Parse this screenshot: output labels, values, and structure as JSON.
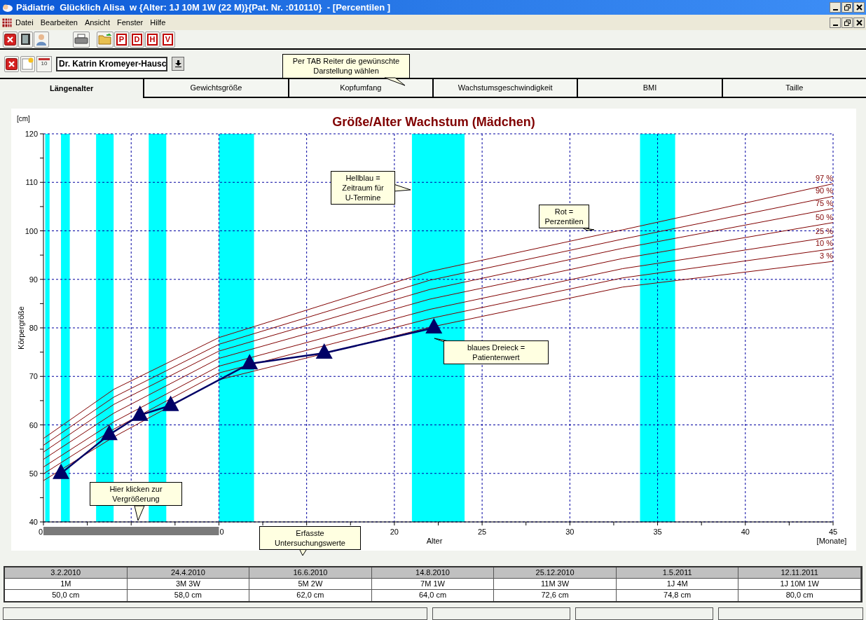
{
  "window": {
    "title": "Pädiatrie  Glücklich Alisa  w {Alter: 1J 10M 1W (22 M)}{Pat. Nr. :010110}  - [Percentilen ]"
  },
  "menu": [
    "Datei",
    "Bearbeiten",
    "Ansicht",
    "Fenster",
    "Hilfe"
  ],
  "toolbar": {
    "letter_buttons": [
      "P",
      "D",
      "H",
      "V"
    ]
  },
  "doctor_bar": {
    "calendar_day": "10",
    "doctor": "Dr. Katrin Kromeyer-Hausc"
  },
  "tab_hint": [
    "Per TAB Reiter die gewünschte",
    "Darstellung wählen"
  ],
  "tabs": [
    {
      "label": "Längenalter",
      "selected": true
    },
    {
      "label": "Gewichtsgröße",
      "selected": false
    },
    {
      "label": "Kopfumfang",
      "selected": false
    },
    {
      "label": "Wachstumsgeschwindigkeit",
      "selected": false
    },
    {
      "label": "BMI",
      "selected": false
    },
    {
      "label": "Taille",
      "selected": false
    }
  ],
  "chart": {
    "y_unit": "[cm]",
    "x_unit": "[Monate]",
    "callouts": [
      {
        "lines": [
          "Hellblau =",
          "Zeitraum für",
          "U-Termine"
        ]
      },
      {
        "lines": [
          "Rot =",
          "Perzentilen"
        ]
      },
      {
        "lines": [
          "blaues Dreieck =",
          "Patientenwert"
        ]
      },
      {
        "lines": [
          "Hier klicken zur",
          "Vergrößerung"
        ]
      },
      {
        "lines": [
          "Erfasste",
          "Untersuchungswerte"
        ]
      }
    ],
    "chart_data": {
      "type": "line",
      "title": "Größe/Alter Wachstum (Mädchen)",
      "xlabel": "Alter",
      "ylabel": "Körpergröße",
      "xlim": [
        0,
        45
      ],
      "ylim": [
        40,
        120
      ],
      "grid": true,
      "xticks": [
        20,
        25,
        30,
        35,
        40,
        45
      ],
      "yticks": [
        40,
        50,
        60,
        70,
        80,
        90,
        100,
        110,
        120
      ],
      "series": [
        {
          "name": "97 %",
          "color": "#800000",
          "x": [
            0,
            4,
            10,
            22,
            33,
            45
          ],
          "values": [
            57.2,
            67.3,
            78.0,
            91.6,
            100.2,
            109.7
          ]
        },
        {
          "name": "90 %",
          "color": "#800000",
          "x": [
            0,
            4,
            10,
            22,
            33,
            45
          ],
          "values": [
            55.8,
            65.7,
            76.6,
            89.8,
            98.3,
            107.1
          ]
        },
        {
          "name": "75 %",
          "color": "#800000",
          "x": [
            0,
            4,
            10,
            22,
            33,
            45
          ],
          "values": [
            54.4,
            64.2,
            75.2,
            87.9,
            96.4,
            104.6
          ]
        },
        {
          "name": "50 %",
          "color": "#800000",
          "x": [
            0,
            4,
            10,
            22,
            33,
            45
          ],
          "values": [
            52.9,
            62.4,
            73.7,
            85.9,
            94.3,
            101.7
          ]
        },
        {
          "name": "25 %",
          "color": "#800000",
          "x": [
            0,
            4,
            10,
            22,
            33,
            45
          ],
          "values": [
            51.3,
            60.6,
            72.1,
            83.8,
            92.2,
            98.8
          ]
        },
        {
          "name": "10 %",
          "color": "#800000",
          "x": [
            0,
            4,
            10,
            22,
            33,
            45
          ],
          "values": [
            49.9,
            59.1,
            70.7,
            81.9,
            90.3,
            96.3
          ]
        },
        {
          "name": "3 %",
          "color": "#800000",
          "x": [
            0,
            4,
            10,
            22,
            33,
            45
          ],
          "values": [
            48.5,
            57.5,
            69.3,
            80.1,
            88.4,
            93.7
          ]
        },
        {
          "color": "#000066",
          "marker": "triangle",
          "x": [
            1,
            3.75,
            5.5,
            7.25,
            11.75,
            16,
            22.25
          ],
          "values": [
            50,
            58,
            62,
            64,
            72.6,
            74.8,
            80
          ]
        }
      ],
      "bands": [
        {
          "axis": "x",
          "from": 0.1,
          "to": 0.35,
          "color": "#00ffff"
        },
        {
          "axis": "x",
          "from": 1,
          "to": 1.5,
          "color": "#00ffff"
        },
        {
          "axis": "x",
          "from": 3,
          "to": 4,
          "color": "#00ffff"
        },
        {
          "axis": "x",
          "from": 6,
          "to": 7,
          "color": "#00ffff"
        },
        {
          "axis": "x",
          "from": 10,
          "to": 12,
          "color": "#00ffff"
        },
        {
          "axis": "x",
          "from": 21,
          "to": 24,
          "color": "#00ffff"
        },
        {
          "axis": "x",
          "from": 34,
          "to": 36,
          "color": "#00ffff"
        }
      ]
    },
    "x_tick_fragments": [
      "0",
      "0"
    ]
  },
  "exam_table": {
    "columns": [
      "3.2.2010",
      "24.4.2010",
      "16.6.2010",
      "14.8.2010",
      "25.12.2010",
      "1.5.2011",
      "12.11.2011"
    ],
    "rows": [
      [
        "1M",
        "3M 3W",
        "5M 2W",
        "7M 1W",
        "11M 3W",
        "1J 4M",
        "1J 10M 1W"
      ],
      [
        "50,0 cm",
        "58,0 cm",
        "62,0 cm",
        "64,0 cm",
        "72,6 cm",
        "74,8 cm",
        "80,0 cm"
      ]
    ]
  }
}
